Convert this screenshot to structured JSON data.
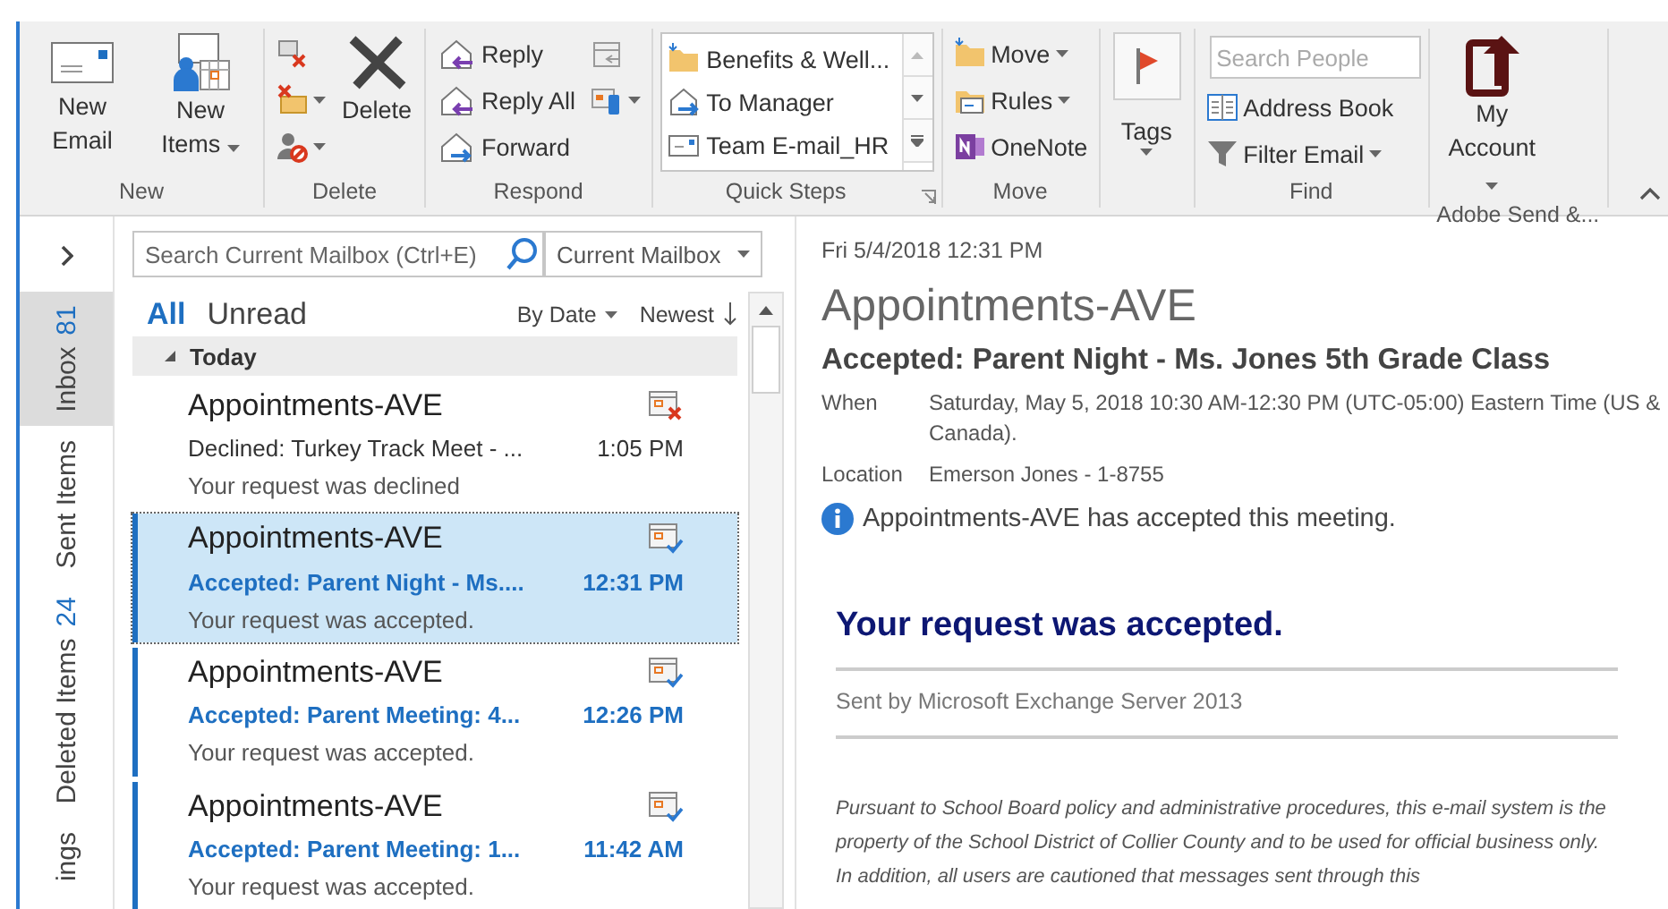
{
  "ribbon": {
    "groups": [
      {
        "label": "New",
        "columns": [
          {
            "kind": "large",
            "buttons": [
              {
                "label": "New Email",
                "dropdown": false
              }
            ]
          },
          {
            "kind": "large",
            "buttons": [
              {
                "label": "New Items",
                "dropdown": true
              }
            ]
          }
        ]
      },
      {
        "label": "Delete",
        "columns": [
          {
            "kind": "stack",
            "buttons": [
              {
                "dropdown": false
              },
              {
                "dropdown": true
              },
              {
                "dropdown": true
              }
            ]
          },
          {
            "kind": "large",
            "buttons": [
              {
                "label": "Delete",
                "dropdown": false
              }
            ]
          }
        ]
      },
      {
        "label": "Respond",
        "columns": [
          {
            "kind": "stack",
            "buttons": [
              {
                "label": "Reply",
                "dropdown": false
              },
              {
                "label": "Reply All",
                "dropdown": false
              },
              {
                "label": "Forward",
                "dropdown": false
              }
            ]
          },
          {
            "kind": "stack",
            "buttons": [
              {
                "dropdown": false
              },
              {
                "dropdown": true
              }
            ]
          }
        ]
      },
      {
        "label": "Quick Steps",
        "launcher": true,
        "columns": [
          {
            "kind": "gallery",
            "buttons": [
              {
                "label": "Benefits & Well..."
              },
              {
                "label": "To Manager"
              },
              {
                "label": "Team E-mail_HR"
              }
            ]
          }
        ]
      },
      {
        "label": "Move",
        "columns": [
          {
            "kind": "stack",
            "buttons": [
              {
                "label": "Move",
                "dropdown": true
              },
              {
                "label": "Rules",
                "dropdown": true
              },
              {
                "label": "OneNote",
                "dropdown": false
              }
            ]
          }
        ]
      },
      {
        "columns": [
          {
            "kind": "flag",
            "buttons": [
              {
                "label": "Tags",
                "dropdown": true
              }
            ]
          }
        ]
      },
      {
        "label": "Find",
        "columns": [
          {
            "kind": "find",
            "placeholder": "Search People",
            "buttons": [
              {
                "label": "Address Book",
                "dropdown": false
              },
              {
                "label": "Filter Email",
                "dropdown": true
              }
            ]
          }
        ]
      },
      {
        "label": "Adobe Send &...",
        "columns": [
          {
            "kind": "large",
            "buttons": [
              {
                "label": "My Account",
                "dropdown": true
              }
            ]
          }
        ]
      }
    ]
  },
  "nav": {
    "tabs": [
      {
        "label": "Inbox",
        "count": "81",
        "selected": true
      },
      {
        "label": "Sent Items",
        "selected": false
      },
      {
        "label": "Deleted Items",
        "count": "24",
        "selected": false
      },
      {
        "label": "ings",
        "selected": false
      }
    ]
  },
  "search": {
    "placeholder": "Search Current Mailbox (Ctrl+E)",
    "scope": "Current Mailbox"
  },
  "filters": [
    {
      "label": "All",
      "selected": true
    },
    {
      "label": "Unread",
      "selected": false
    }
  ],
  "sort": {
    "by": "By Date",
    "order": "Newest"
  },
  "group_header": "Today",
  "messages": [
    {
      "sender": "Appointments-AVE",
      "subject": "Declined: Turkey Track Meet - ...",
      "preview": "Your request was declined",
      "time": "1:05 PM",
      "kind": "declined",
      "unread": false,
      "selected": false
    },
    {
      "sender": "Appointments-AVE",
      "subject": "Accepted: Parent Night - Ms....",
      "preview": "Your request was accepted.",
      "time": "12:31 PM",
      "kind": "accepted",
      "unread": true,
      "selected": true
    },
    {
      "sender": "Appointments-AVE",
      "subject": "Accepted: Parent Meeting:  4...",
      "preview": "Your request was accepted.",
      "time": "12:26 PM",
      "kind": "accepted",
      "unread": true,
      "selected": false
    },
    {
      "sender": "Appointments-AVE",
      "subject": "Accepted: Parent Meeting:  1...",
      "preview": "Your request was accepted.",
      "time": "11:42 AM",
      "kind": "accepted",
      "unread": true,
      "selected": false
    }
  ],
  "reading": {
    "date": "Fri 5/4/2018 12:31 PM",
    "sender": "Appointments-AVE",
    "subject": "Accepted: Parent Night - Ms. Jones 5th Grade Class",
    "fields": [
      {
        "label": "When",
        "value": "Saturday, May 5, 2018 10:30 AM-12:30 PM (UTC-05:00) Eastern Time (US & Canada)."
      },
      {
        "label": "Location",
        "value": "Emerson Jones - 1-8755"
      }
    ],
    "info": "Appointments-AVE has accepted this meeting.",
    "body_heading": "Your request was accepted.",
    "sent_by": "Sent by Microsoft Exchange Server 2013",
    "disclaimer": "Pursuant to School Board policy and administrative procedures, this e-mail system is the property of the School District of Collier County and to be used for official business only. In addition, all users are cautioned that messages sent through this"
  }
}
